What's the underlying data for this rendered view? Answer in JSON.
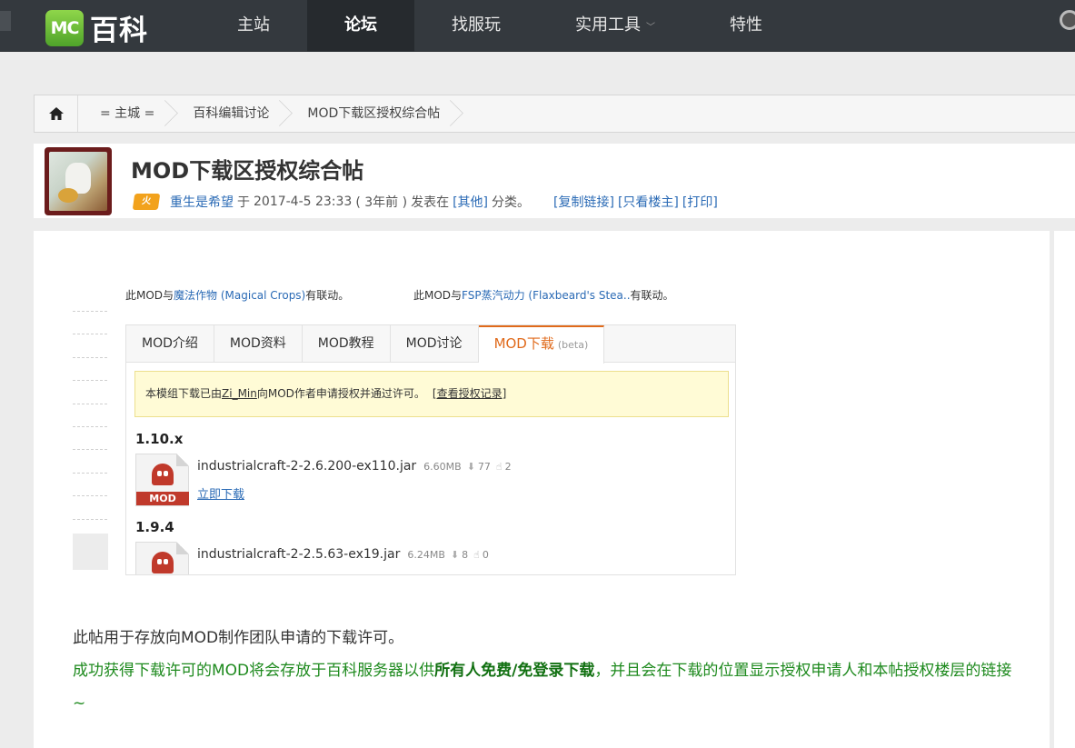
{
  "logo": {
    "mc": "MC",
    "text": "百科"
  },
  "nav": [
    {
      "label": "主站"
    },
    {
      "label": "论坛",
      "active": true
    },
    {
      "label": "找服玩"
    },
    {
      "label": "实用工具",
      "caret": "﹀"
    },
    {
      "label": "特性"
    }
  ],
  "breadcrumb": {
    "items": [
      "= 主城 =",
      "百科编辑讨论",
      "MOD下载区授权综合帖"
    ]
  },
  "post": {
    "title": "MOD下载区授权综合帖",
    "badge": "火",
    "author": "重生是希望",
    "meta_yu": "于",
    "time": "2017-4-5 23:33",
    "ago": "( 3年前 )",
    "meta_posted": "发表在",
    "category": "[其他]",
    "meta_cat": "分类。",
    "copy_link": "[复制链接]",
    "only_op": "[只看楼主]",
    "print": "[打印]"
  },
  "related": {
    "r1_pre": "此MOD与",
    "r1_link": "魔法作物 (Magical Crops)",
    "r1_post": "有联动。",
    "r2_pre": "此MOD与",
    "r2_link": "FSP蒸汽动力 (Flaxbeard's Stea..",
    "r2_post": "有联动。"
  },
  "embed": {
    "tabs": [
      "MOD介绍",
      "MOD资料",
      "MOD教程",
      "MOD讨论"
    ],
    "active_tab": "MOD下载",
    "beta": "(beta)",
    "notice_pre": "本模组下载已由",
    "notice_user": "Zi_Min",
    "notice_post": "向MOD作者申请授权并通过许可。",
    "notice_record": "[查看授权记录]",
    "versions": [
      {
        "version": "1.10.x",
        "file": "industrialcraft-2-2.6.200-ex110.jar",
        "size": "6.60MB",
        "downloads": "77",
        "likes": "2",
        "download_label": "立即下载"
      },
      {
        "version": "1.9.4",
        "file": "industrialcraft-2-2.5.63-ex19.jar",
        "size": "6.24MB",
        "downloads": "8",
        "likes": "0"
      }
    ],
    "mod_tag": "MOD"
  },
  "body": {
    "p1": "此帖用于存放向MOD制作团队申请的下载许可。",
    "p2a": "成功获得下载许可的MOD将会存放于百科服务器以供",
    "p2b": "所有人免费/免登录下载",
    "p2c": "，并且会在下载的位置显示授权申请人和本帖授权楼层的链接~"
  },
  "colors": {
    "topbar": "#34393e",
    "link": "#2a6ab5",
    "accent": "#e06a1b",
    "green": "#1e8a1e"
  },
  "icons": [
    "home-icon",
    "gear-icon",
    "download-icon",
    "like-icon",
    "mod-ghost-icon"
  ]
}
